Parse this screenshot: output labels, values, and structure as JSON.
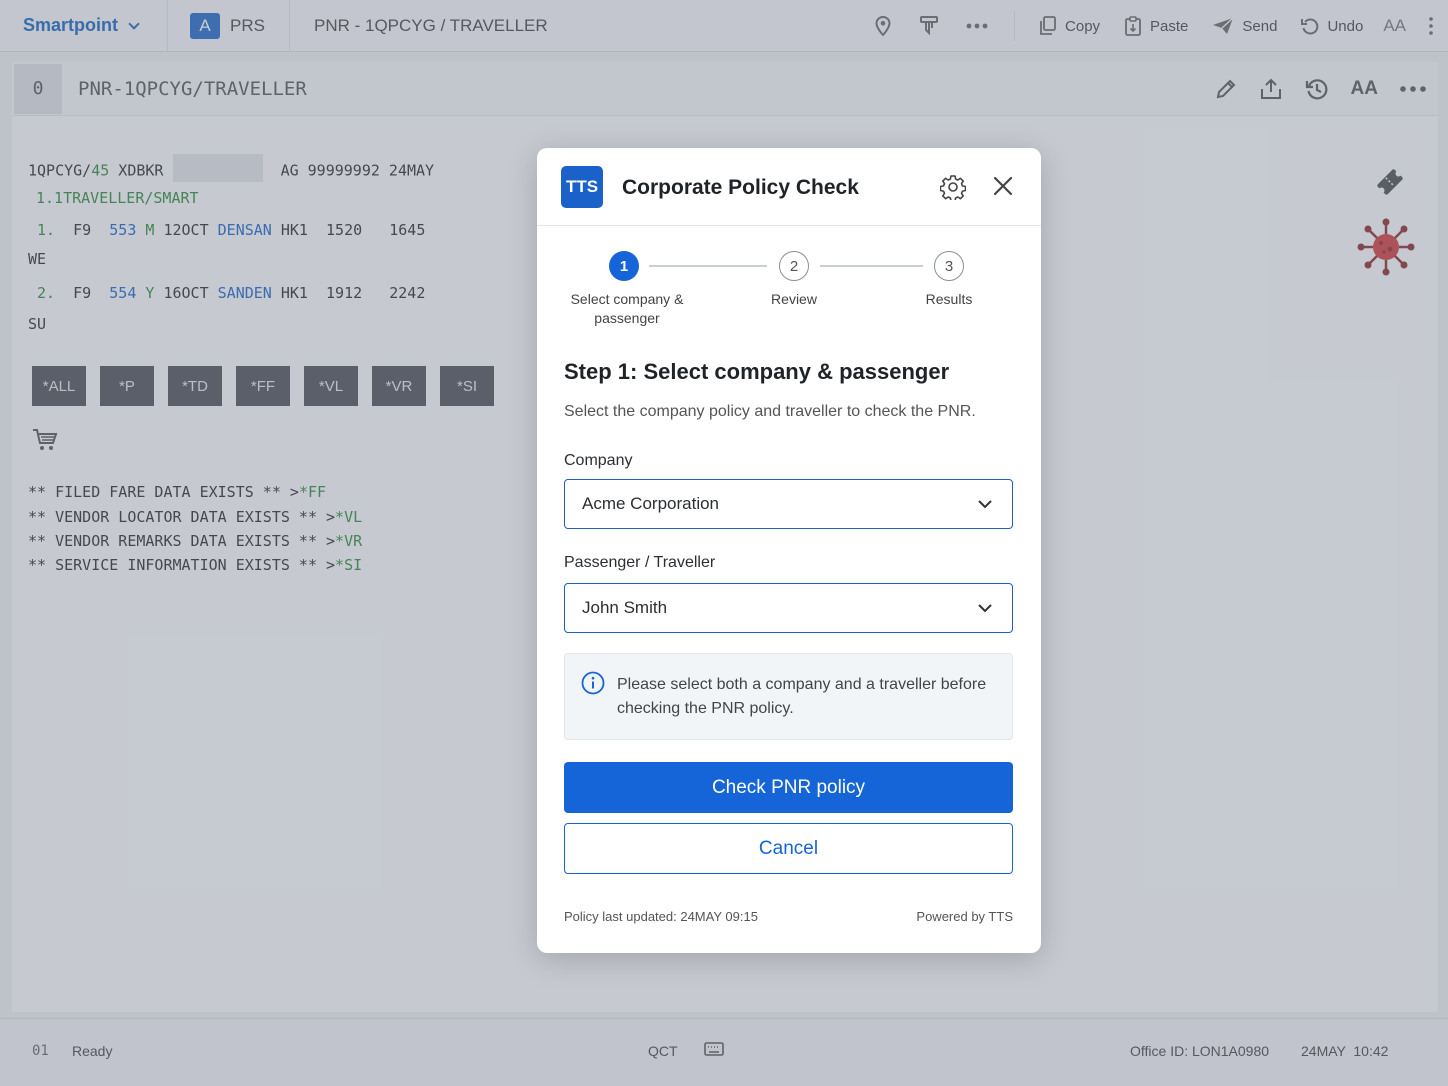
{
  "topbar": {
    "brand": "Smartpoint",
    "tab_letter": "A",
    "tab_label": "PRS",
    "pnr_title": "PNR - 1QPCYG / TRAVELLER",
    "actions": {
      "copy": "Copy",
      "paste": "Paste",
      "send": "Send",
      "undo": "Undo",
      "font_size": "AA"
    }
  },
  "subheader": {
    "index": "0",
    "title": "PNR-1QPCYG/TRAVELLER",
    "font_size": "AA"
  },
  "terminal": {
    "line1_a": "1QPCYG/",
    "line1_b": "45",
    "line1_c": " XDBKR ",
    "line1_d": "AG 99999992 24MAY",
    "passenger": "1.1TRAVELLER/SMART",
    "segments": [
      {
        "num": "1.",
        "carrier": "F9",
        "flight": "553",
        "cls": "M",
        "date": "12OCT",
        "route": "DENSAN",
        "status": "HK1",
        "dep": "1520",
        "arr": "1645",
        "day": "WE"
      },
      {
        "num": "2.",
        "carrier": "F9",
        "flight": "554",
        "cls": "Y",
        "date": "16OCT",
        "route": "SANDEN",
        "status": "HK1",
        "dep": "1912",
        "arr": "2242",
        "day": "SU"
      }
    ],
    "commands": [
      "*ALL",
      "*P",
      "*TD",
      "*FF",
      "*VL",
      "*VR",
      "*SI"
    ],
    "notices": [
      {
        "text": "** FILED FARE DATA EXISTS ** >",
        "cmd": "*FF"
      },
      {
        "text": "** VENDOR LOCATOR DATA EXISTS ** >",
        "cmd": "*VL"
      },
      {
        "text": "** VENDOR REMARKS DATA EXISTS ** >",
        "cmd": "*VR"
      },
      {
        "text": "** SERVICE INFORMATION EXISTS ** >",
        "cmd": "*SI"
      }
    ]
  },
  "statusbar": {
    "index": "01",
    "status": "Ready",
    "qct": "QCT",
    "office": "Office ID: LON1A0980",
    "datetime": "24MAY  10:42"
  },
  "modal": {
    "logo": "TTS",
    "title": "Corporate Policy Check",
    "steps": [
      {
        "num": "1",
        "label_line1": "Select company &",
        "label_line2": "passenger"
      },
      {
        "num": "2",
        "label_line1": "Review",
        "label_line2": ""
      },
      {
        "num": "3",
        "label_line1": "Results",
        "label_line2": ""
      }
    ],
    "heading": "Step 1: Select company & passenger",
    "description": "Select the company policy and traveller to check the PNR.",
    "company_label": "Company",
    "company_value": "Acme Corporation",
    "passenger_label": "Passenger / Traveller",
    "passenger_value": "John Smith",
    "info_text": "Please select both a company and a traveller before checking the PNR policy.",
    "primary_button": "Check PNR policy",
    "cancel_button": "Cancel",
    "footer_left": "Policy last updated: 24MAY 09:15",
    "footer_right": "Powered by TTS"
  },
  "colors": {
    "accent": "#1565d8",
    "brand": "#1565c0",
    "terminal_blue": "#1a63c6",
    "terminal_green": "#2e8a3a",
    "overlay": "rgba(112,122,138,0.38)"
  }
}
